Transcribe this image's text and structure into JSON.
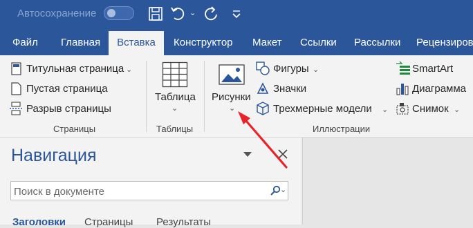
{
  "titlebar": {
    "autosave_label": "Автосохранение"
  },
  "tabs": [
    {
      "label": "Файл"
    },
    {
      "label": "Главная"
    },
    {
      "label": "Вставка",
      "active": true
    },
    {
      "label": "Конструктор"
    },
    {
      "label": "Макет"
    },
    {
      "label": "Ссылки"
    },
    {
      "label": "Рассылки"
    },
    {
      "label": "Рецензиров"
    }
  ],
  "ribbon": {
    "pages": {
      "items": [
        {
          "label": "Титульная страница",
          "icon": "cover-page-icon"
        },
        {
          "label": "Пустая страница",
          "icon": "blank-page-icon"
        },
        {
          "label": "Разрыв страницы",
          "icon": "page-break-icon"
        }
      ],
      "group_label": "Страницы"
    },
    "tables": {
      "button_label": "Таблица",
      "group_label": "Таблицы"
    },
    "illustrations": {
      "pictures_label": "Рисунки",
      "shapes_label": "Фигуры",
      "icons_label": "Значки",
      "models_label": "Трехмерные модели",
      "smartart_label": "SmartArt",
      "chart_label": "Диаграмма",
      "screenshot_label": "Снимок",
      "group_label": "Иллюстрации"
    }
  },
  "nav": {
    "title": "Навигация",
    "search_placeholder": "Поиск в документе",
    "tabs": [
      {
        "label": "Заголовки"
      },
      {
        "label": "Страницы"
      },
      {
        "label": "Результаты"
      }
    ]
  },
  "colors": {
    "brand": "#2b579a",
    "ribbon_bg": "#f3f3f3",
    "annotation_arrow": "#e8232a"
  }
}
